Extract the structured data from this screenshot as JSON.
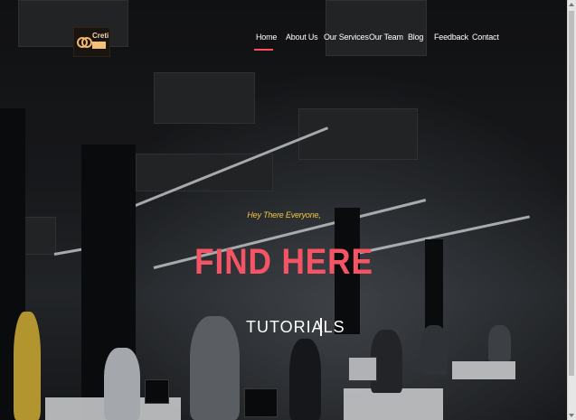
{
  "brand": {
    "logo_text": "Creti"
  },
  "nav": {
    "items": [
      "Home",
      "About Us",
      "Our Services",
      "Our Team",
      "Blog",
      "Feedback",
      "Contact"
    ],
    "active": "Home"
  },
  "hero": {
    "greeting": "Hey There Everyone,",
    "headline": "FIND HERE",
    "typed_text": "TUTORIALS"
  },
  "colors": {
    "accent": "#f45463",
    "greeting": "#f4c73e",
    "nav_text": "#ffffff"
  }
}
